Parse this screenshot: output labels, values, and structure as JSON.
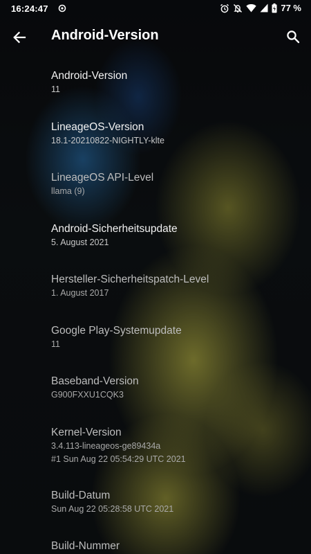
{
  "status_bar": {
    "time": "16:24:47",
    "battery": "77 %"
  },
  "app_bar": {
    "title": "Android-Version"
  },
  "items": [
    {
      "title": "Android-Version",
      "summary": "11"
    },
    {
      "title": "LineageOS-Version",
      "summary": "18.1-20210822-NIGHTLY-klte"
    },
    {
      "title": "LineageOS API-Level",
      "summary": "llama (9)"
    },
    {
      "title": "Android-Sicherheitsupdate",
      "summary": "5. August 2021"
    },
    {
      "title": "Hersteller-Sicherheitspatch-Level",
      "summary": "1. August 2017"
    },
    {
      "title": "Google Play-Systemupdate",
      "summary": "11"
    },
    {
      "title": "Baseband-Version",
      "summary": "G900FXXU1CQK3"
    },
    {
      "title": "Kernel-Version",
      "summary": "3.4.113-lineageos-ge89434a",
      "summary2": "#1 Sun Aug 22 05:54:29 UTC 2021"
    },
    {
      "title": "Build-Datum",
      "summary": "Sun Aug 22 05:28:58 UTC 2021"
    },
    {
      "title": "Build-Nummer",
      "summary": ""
    }
  ]
}
